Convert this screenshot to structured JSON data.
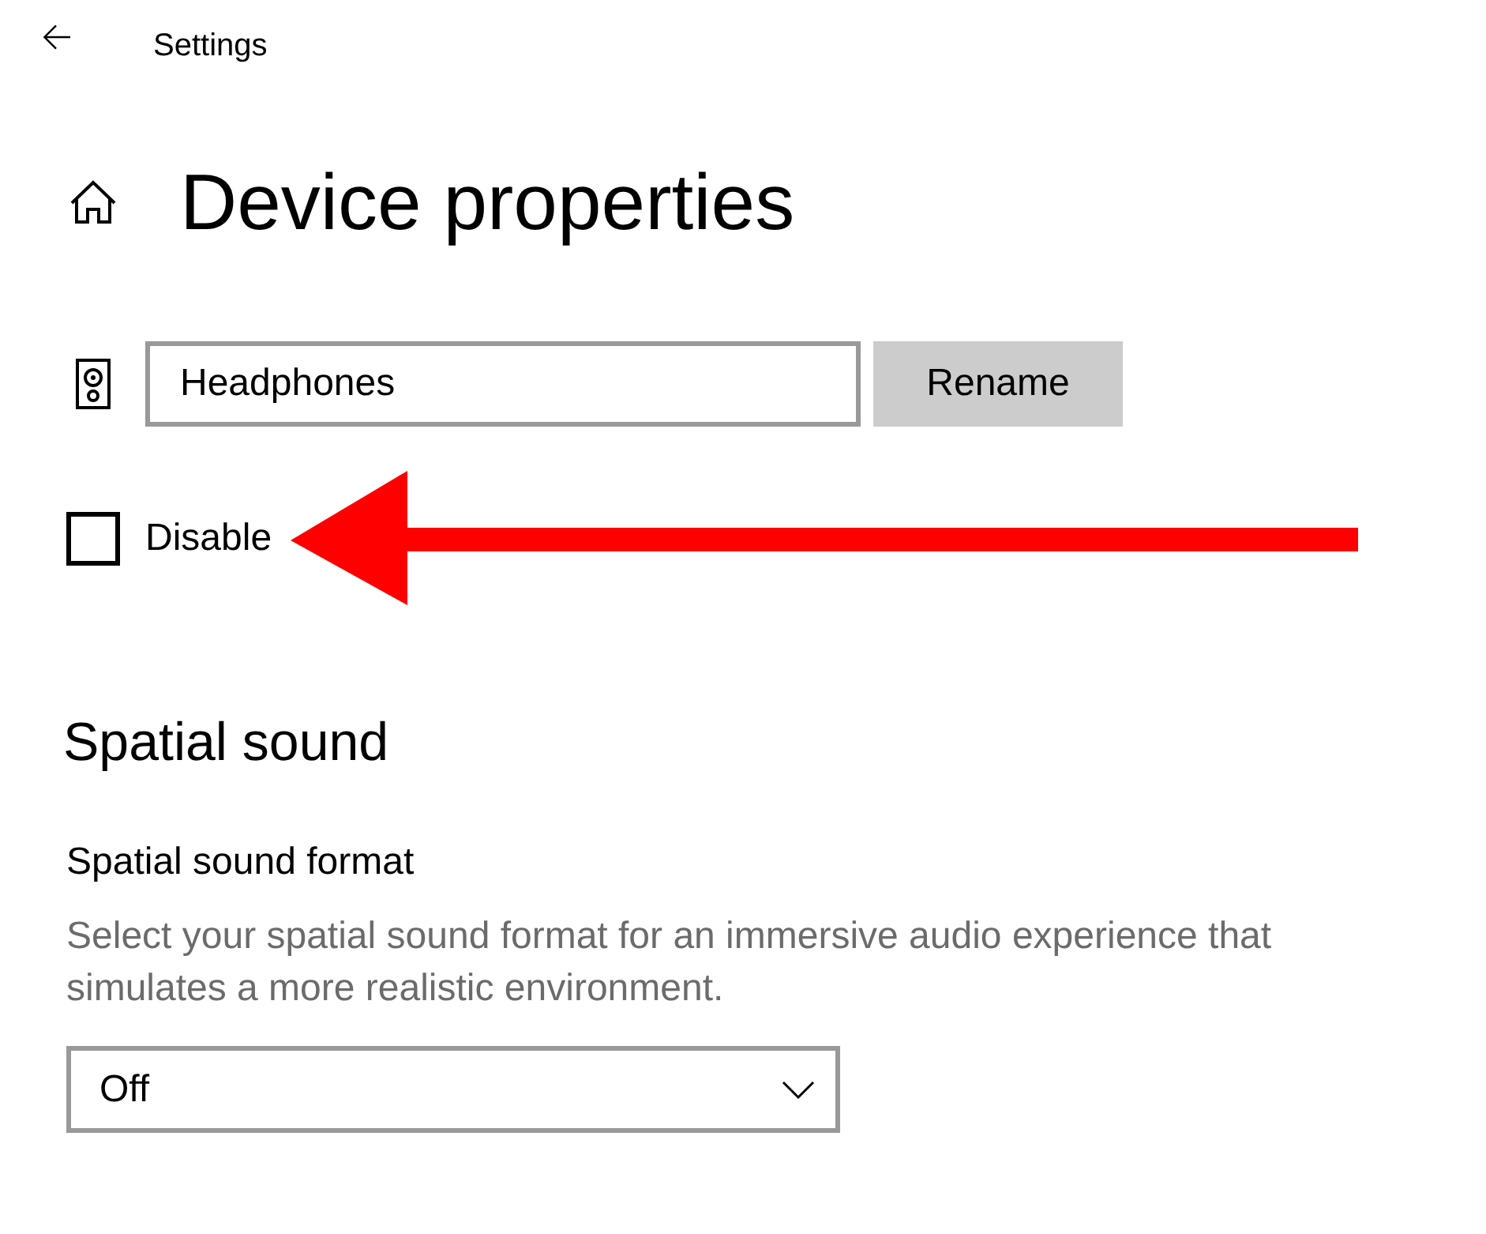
{
  "window": {
    "title": "Settings"
  },
  "page": {
    "title": "Device properties"
  },
  "device": {
    "name": "Headphones",
    "rename_button": "Rename"
  },
  "disable": {
    "label": "Disable",
    "checked": false,
    "callout": {
      "kind": "arrow"
    }
  },
  "spatial_sound": {
    "heading": "Spatial sound",
    "format_label": "Spatial sound format",
    "description": "Select your spatial sound format for an immersive audio experience that simulates a more realistic environment.",
    "dropdown": {
      "value": "Off"
    }
  }
}
